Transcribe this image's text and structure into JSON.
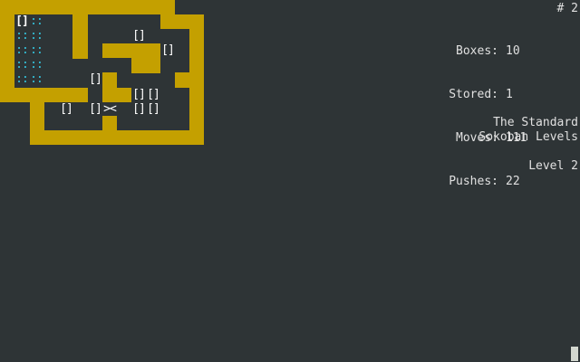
{
  "game": {
    "level_number_mark": "# 2",
    "stats": [
      {
        "label": "Boxes:",
        "value": "10"
      },
      {
        "label": "Stored:",
        "value": "1"
      },
      {
        "label": "Moves:",
        "value": "111"
      },
      {
        "label": "Pushes:",
        "value": "22"
      }
    ],
    "collection_line1": "The Standard",
    "collection_line2": "Sokoban Levels",
    "level_label": "Level 2"
  },
  "glyphs": {
    "goal": "::",
    "box": "[]",
    "player": "><"
  },
  "colors": {
    "background": "#2e3436",
    "wall": "#c4a000",
    "goal": "#34c6e0",
    "text": "#ffffff"
  }
}
